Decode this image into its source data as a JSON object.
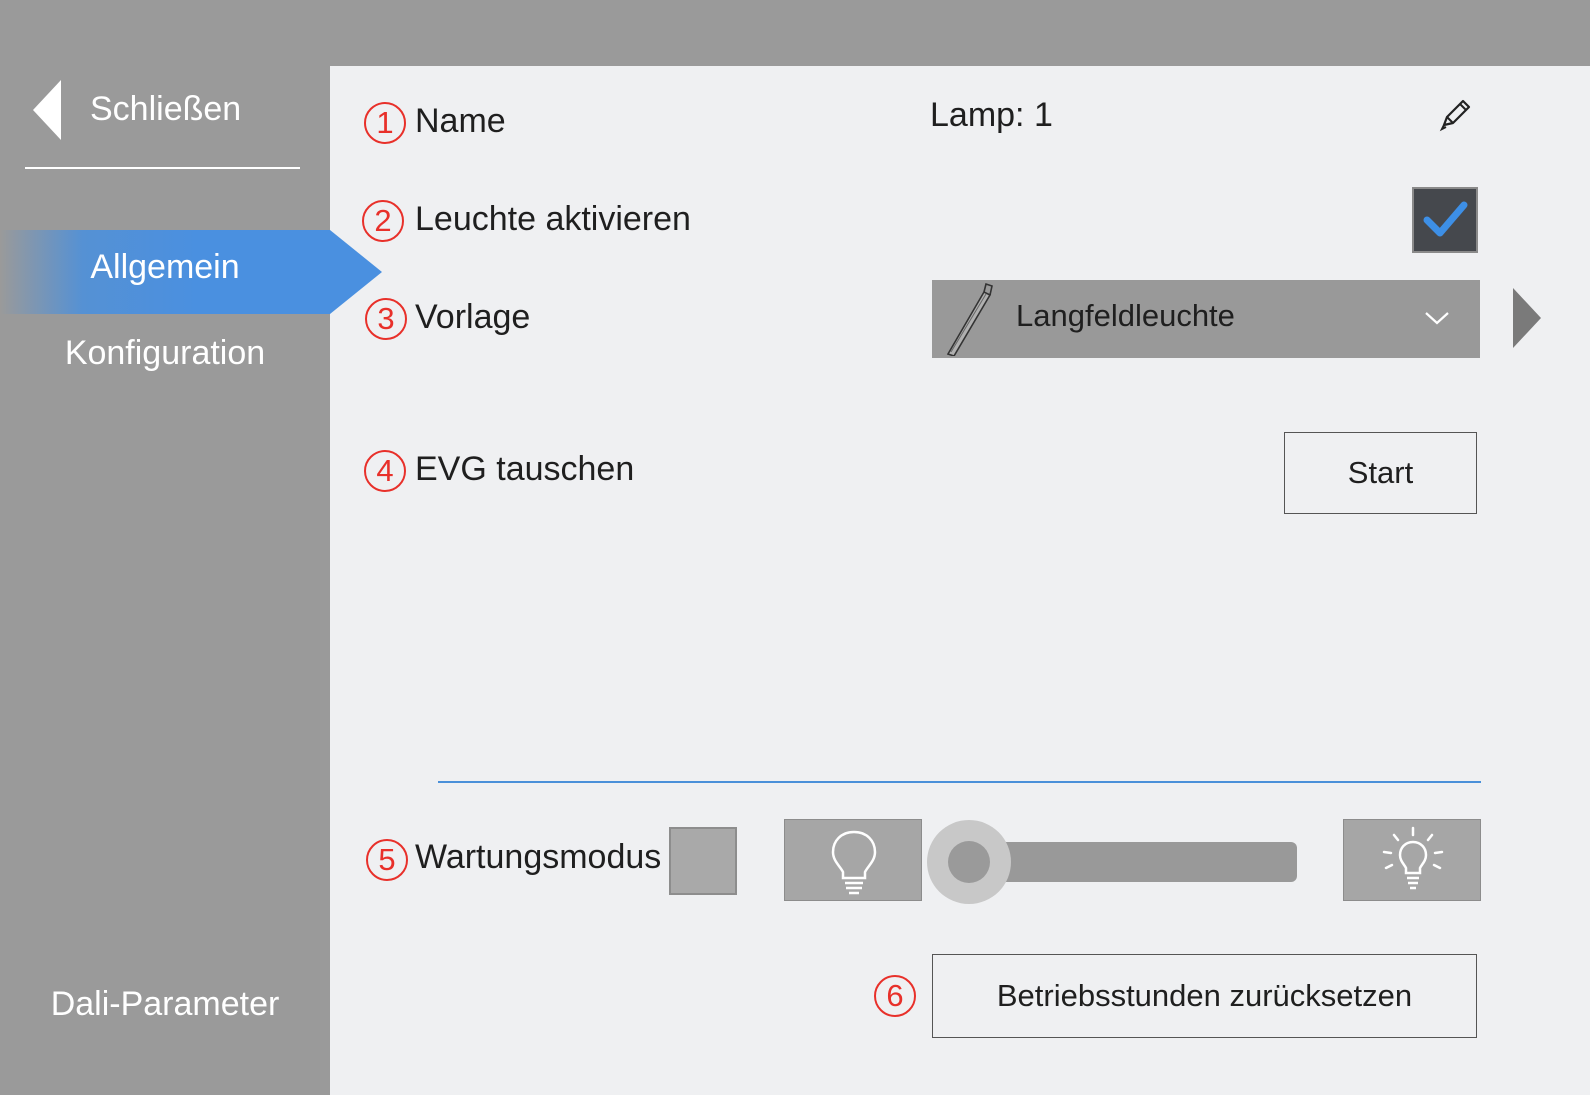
{
  "sidebar": {
    "back_label": "Schließen",
    "items": [
      {
        "label": "Allgemein",
        "active": true
      },
      {
        "label": "Konfiguration",
        "active": false
      }
    ],
    "footer_label": "Dali-Parameter"
  },
  "form": {
    "name": {
      "marker": "1",
      "label": "Name",
      "value": "Lamp: 1",
      "icon": "pencil-icon"
    },
    "activate": {
      "marker": "2",
      "label": "Leuchte aktivieren",
      "checked": true
    },
    "template": {
      "marker": "3",
      "label": "Vorlage",
      "selected": "Langfeldleuchte",
      "icon": "linear-lamp-icon"
    },
    "ballast": {
      "marker": "4",
      "label": "EVG tauschen",
      "button_label": "Start"
    },
    "maintenance": {
      "marker": "5",
      "label": "Wartungsmodus",
      "checked": false,
      "dim_level_fraction": 0.0
    },
    "reset": {
      "marker": "6",
      "button_label": "Betriebsstunden zurücksetzen"
    }
  },
  "colors": {
    "accent": "#4a90e0",
    "marker": "#e8302a",
    "checkmark": "#3d8fe6",
    "sidebar_bg": "#9a9a9a",
    "content_bg": "#eff0f2"
  }
}
